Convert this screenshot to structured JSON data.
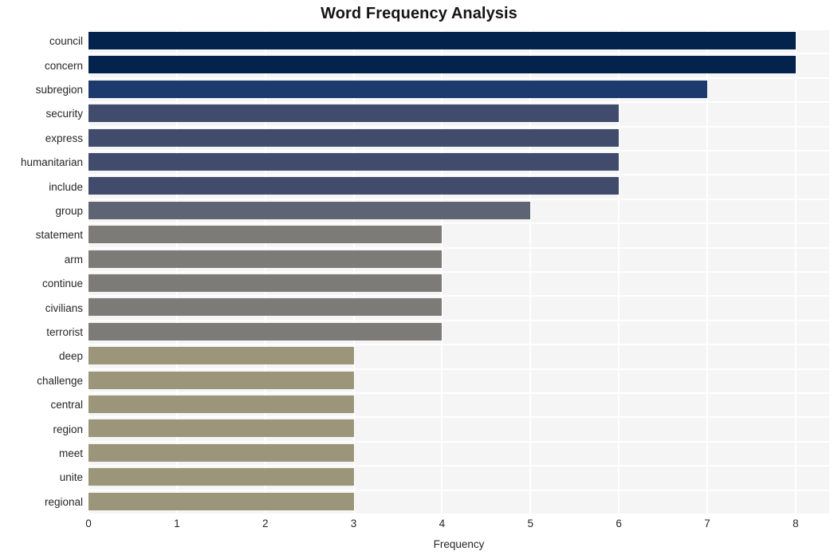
{
  "chart_data": {
    "type": "bar",
    "orientation": "horizontal",
    "title": "Word Frequency Analysis",
    "xlabel": "Frequency",
    "ylabel": "",
    "xlim": [
      0,
      8.38
    ],
    "xticks": [
      0,
      1,
      2,
      3,
      4,
      5,
      6,
      7,
      8
    ],
    "xtick_labels": [
      "0",
      "1",
      "2",
      "3",
      "4",
      "5",
      "6",
      "7",
      "8"
    ],
    "grid": true,
    "legend": false,
    "categories": [
      "council",
      "concern",
      "subregion",
      "security",
      "express",
      "humanitarian",
      "include",
      "group",
      "statement",
      "arm",
      "continue",
      "civilians",
      "terrorist",
      "deep",
      "challenge",
      "central",
      "region",
      "meet",
      "unite",
      "regional"
    ],
    "values": [
      8,
      8,
      7,
      6,
      6,
      6,
      6,
      5,
      4,
      4,
      4,
      4,
      4,
      3,
      3,
      3,
      3,
      3,
      3,
      3
    ],
    "bar_colors": [
      "#04234c",
      "#04234c",
      "#1d3a6e",
      "#414b6b",
      "#414b6b",
      "#414b6b",
      "#414b6b",
      "#5e6473",
      "#7c7b77",
      "#7c7b77",
      "#7c7b77",
      "#7c7b77",
      "#7c7b77",
      "#9b9579",
      "#9b9579",
      "#9b9579",
      "#9b9579",
      "#9b9579",
      "#9b9579",
      "#9b9579"
    ],
    "plot_background": "#f5f5f6",
    "grid_color": "#ffffff",
    "figure_background": "#ffffff"
  }
}
